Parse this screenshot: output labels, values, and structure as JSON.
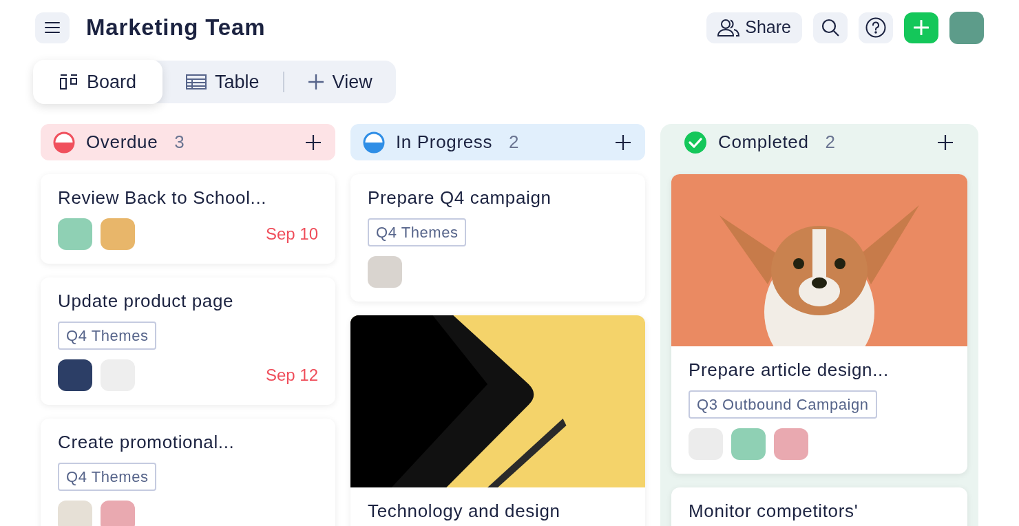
{
  "header": {
    "title": "Marketing Team",
    "share_label": "Share"
  },
  "views": [
    {
      "label": "Board",
      "kind": "board",
      "selected": true
    },
    {
      "label": "Table",
      "kind": "table",
      "selected": false
    },
    {
      "label": "View",
      "kind": "add",
      "selected": false
    }
  ],
  "columns": [
    {
      "kind": "overdue",
      "title": "Overdue",
      "count": "3",
      "cards": [
        {
          "kind": "plain",
          "title": "Review Back to School...",
          "avatars": [
            {
              "color": "#8fd0b4"
            },
            {
              "color": "#e8b66a"
            }
          ],
          "due": "Sep 10"
        },
        {
          "kind": "plain",
          "title": "Update product page",
          "tag": "Q4 Themes",
          "avatars": [
            {
              "color": "#2c3e66"
            },
            {
              "color": "#eeeeee"
            }
          ],
          "due": "Sep 12"
        },
        {
          "kind": "plain",
          "title": "Create promotional...",
          "tag": "Q4 Themes",
          "avatars": [
            {
              "color": "#e6e0d6"
            },
            {
              "color": "#e9a9b0"
            }
          ]
        }
      ]
    },
    {
      "kind": "in_progress",
      "title": "In Progress",
      "count": "2",
      "cards": [
        {
          "kind": "plain",
          "title": "Prepare Q4 campaign",
          "tag": "Q4 Themes",
          "avatars": [
            {
              "color": "#d9d4cf"
            }
          ]
        },
        {
          "kind": "tablet",
          "title": "Technology and design"
        }
      ]
    },
    {
      "kind": "completed",
      "title": "Completed",
      "count": "2",
      "cards": [
        {
          "kind": "dog",
          "title": "Prepare article design...",
          "tag": "Q3 Outbound Campaign",
          "avatars": [
            {
              "color": "#ececec"
            },
            {
              "color": "#8fd0b4"
            },
            {
              "color": "#e9a9b0"
            }
          ]
        },
        {
          "kind": "plain",
          "title": "Monitor competitors'"
        }
      ]
    }
  ]
}
